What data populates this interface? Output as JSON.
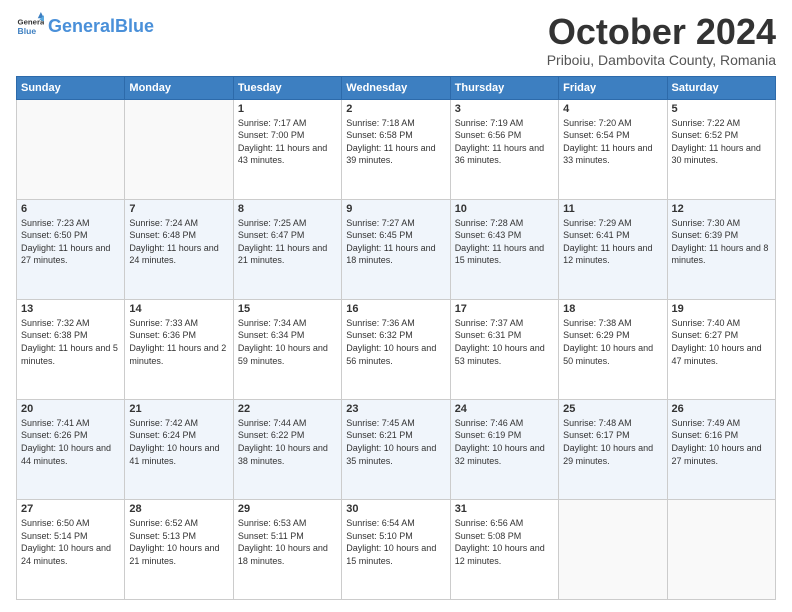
{
  "header": {
    "logo_general": "General",
    "logo_blue": "Blue",
    "month": "October 2024",
    "location": "Priboiu, Dambovita County, Romania"
  },
  "days_of_week": [
    "Sunday",
    "Monday",
    "Tuesday",
    "Wednesday",
    "Thursday",
    "Friday",
    "Saturday"
  ],
  "weeks": [
    [
      {
        "day": "",
        "content": ""
      },
      {
        "day": "",
        "content": ""
      },
      {
        "day": "1",
        "content": "Sunrise: 7:17 AM\nSunset: 7:00 PM\nDaylight: 11 hours and 43 minutes."
      },
      {
        "day": "2",
        "content": "Sunrise: 7:18 AM\nSunset: 6:58 PM\nDaylight: 11 hours and 39 minutes."
      },
      {
        "day": "3",
        "content": "Sunrise: 7:19 AM\nSunset: 6:56 PM\nDaylight: 11 hours and 36 minutes."
      },
      {
        "day": "4",
        "content": "Sunrise: 7:20 AM\nSunset: 6:54 PM\nDaylight: 11 hours and 33 minutes."
      },
      {
        "day": "5",
        "content": "Sunrise: 7:22 AM\nSunset: 6:52 PM\nDaylight: 11 hours and 30 minutes."
      }
    ],
    [
      {
        "day": "6",
        "content": "Sunrise: 7:23 AM\nSunset: 6:50 PM\nDaylight: 11 hours and 27 minutes."
      },
      {
        "day": "7",
        "content": "Sunrise: 7:24 AM\nSunset: 6:48 PM\nDaylight: 11 hours and 24 minutes."
      },
      {
        "day": "8",
        "content": "Sunrise: 7:25 AM\nSunset: 6:47 PM\nDaylight: 11 hours and 21 minutes."
      },
      {
        "day": "9",
        "content": "Sunrise: 7:27 AM\nSunset: 6:45 PM\nDaylight: 11 hours and 18 minutes."
      },
      {
        "day": "10",
        "content": "Sunrise: 7:28 AM\nSunset: 6:43 PM\nDaylight: 11 hours and 15 minutes."
      },
      {
        "day": "11",
        "content": "Sunrise: 7:29 AM\nSunset: 6:41 PM\nDaylight: 11 hours and 12 minutes."
      },
      {
        "day": "12",
        "content": "Sunrise: 7:30 AM\nSunset: 6:39 PM\nDaylight: 11 hours and 8 minutes."
      }
    ],
    [
      {
        "day": "13",
        "content": "Sunrise: 7:32 AM\nSunset: 6:38 PM\nDaylight: 11 hours and 5 minutes."
      },
      {
        "day": "14",
        "content": "Sunrise: 7:33 AM\nSunset: 6:36 PM\nDaylight: 11 hours and 2 minutes."
      },
      {
        "day": "15",
        "content": "Sunrise: 7:34 AM\nSunset: 6:34 PM\nDaylight: 10 hours and 59 minutes."
      },
      {
        "day": "16",
        "content": "Sunrise: 7:36 AM\nSunset: 6:32 PM\nDaylight: 10 hours and 56 minutes."
      },
      {
        "day": "17",
        "content": "Sunrise: 7:37 AM\nSunset: 6:31 PM\nDaylight: 10 hours and 53 minutes."
      },
      {
        "day": "18",
        "content": "Sunrise: 7:38 AM\nSunset: 6:29 PM\nDaylight: 10 hours and 50 minutes."
      },
      {
        "day": "19",
        "content": "Sunrise: 7:40 AM\nSunset: 6:27 PM\nDaylight: 10 hours and 47 minutes."
      }
    ],
    [
      {
        "day": "20",
        "content": "Sunrise: 7:41 AM\nSunset: 6:26 PM\nDaylight: 10 hours and 44 minutes."
      },
      {
        "day": "21",
        "content": "Sunrise: 7:42 AM\nSunset: 6:24 PM\nDaylight: 10 hours and 41 minutes."
      },
      {
        "day": "22",
        "content": "Sunrise: 7:44 AM\nSunset: 6:22 PM\nDaylight: 10 hours and 38 minutes."
      },
      {
        "day": "23",
        "content": "Sunrise: 7:45 AM\nSunset: 6:21 PM\nDaylight: 10 hours and 35 minutes."
      },
      {
        "day": "24",
        "content": "Sunrise: 7:46 AM\nSunset: 6:19 PM\nDaylight: 10 hours and 32 minutes."
      },
      {
        "day": "25",
        "content": "Sunrise: 7:48 AM\nSunset: 6:17 PM\nDaylight: 10 hours and 29 minutes."
      },
      {
        "day": "26",
        "content": "Sunrise: 7:49 AM\nSunset: 6:16 PM\nDaylight: 10 hours and 27 minutes."
      }
    ],
    [
      {
        "day": "27",
        "content": "Sunrise: 6:50 AM\nSunset: 5:14 PM\nDaylight: 10 hours and 24 minutes."
      },
      {
        "day": "28",
        "content": "Sunrise: 6:52 AM\nSunset: 5:13 PM\nDaylight: 10 hours and 21 minutes."
      },
      {
        "day": "29",
        "content": "Sunrise: 6:53 AM\nSunset: 5:11 PM\nDaylight: 10 hours and 18 minutes."
      },
      {
        "day": "30",
        "content": "Sunrise: 6:54 AM\nSunset: 5:10 PM\nDaylight: 10 hours and 15 minutes."
      },
      {
        "day": "31",
        "content": "Sunrise: 6:56 AM\nSunset: 5:08 PM\nDaylight: 10 hours and 12 minutes."
      },
      {
        "day": "",
        "content": ""
      },
      {
        "day": "",
        "content": ""
      }
    ]
  ]
}
